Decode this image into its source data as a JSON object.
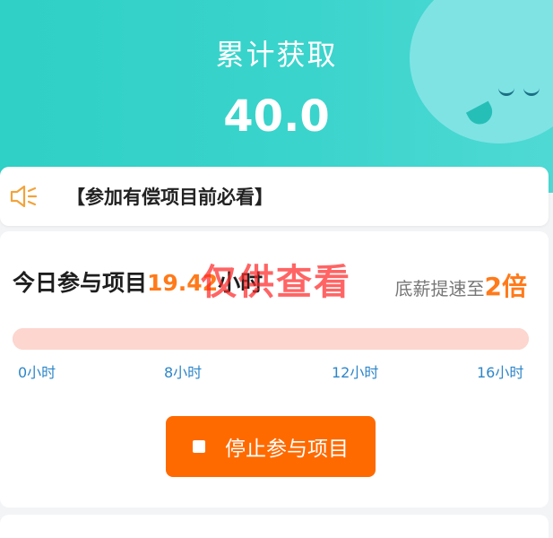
{
  "header": {
    "title": "累计获取",
    "value": "40.0"
  },
  "notice": {
    "text": "【参加有偿项目前必看】",
    "icon": "speaker-icon"
  },
  "today": {
    "prefix": "今日参与项目",
    "hours": "19.42",
    "unit": "小时",
    "speed_prefix": "底薪提速至",
    "speed_value": "2倍"
  },
  "watermark": "仅供查看",
  "progress": {
    "fraction": 1.0,
    "ticks": [
      "0小时",
      "8小时",
      "12小时",
      "16小时"
    ]
  },
  "action": {
    "stop_label": "停止参与项目",
    "icon": "stop-icon"
  },
  "colors": {
    "header": "#33d2c9",
    "accent": "#ff7a1a",
    "button": "#ff6a00",
    "bar": "#fcd6cf",
    "tick": "#2d86c9"
  }
}
